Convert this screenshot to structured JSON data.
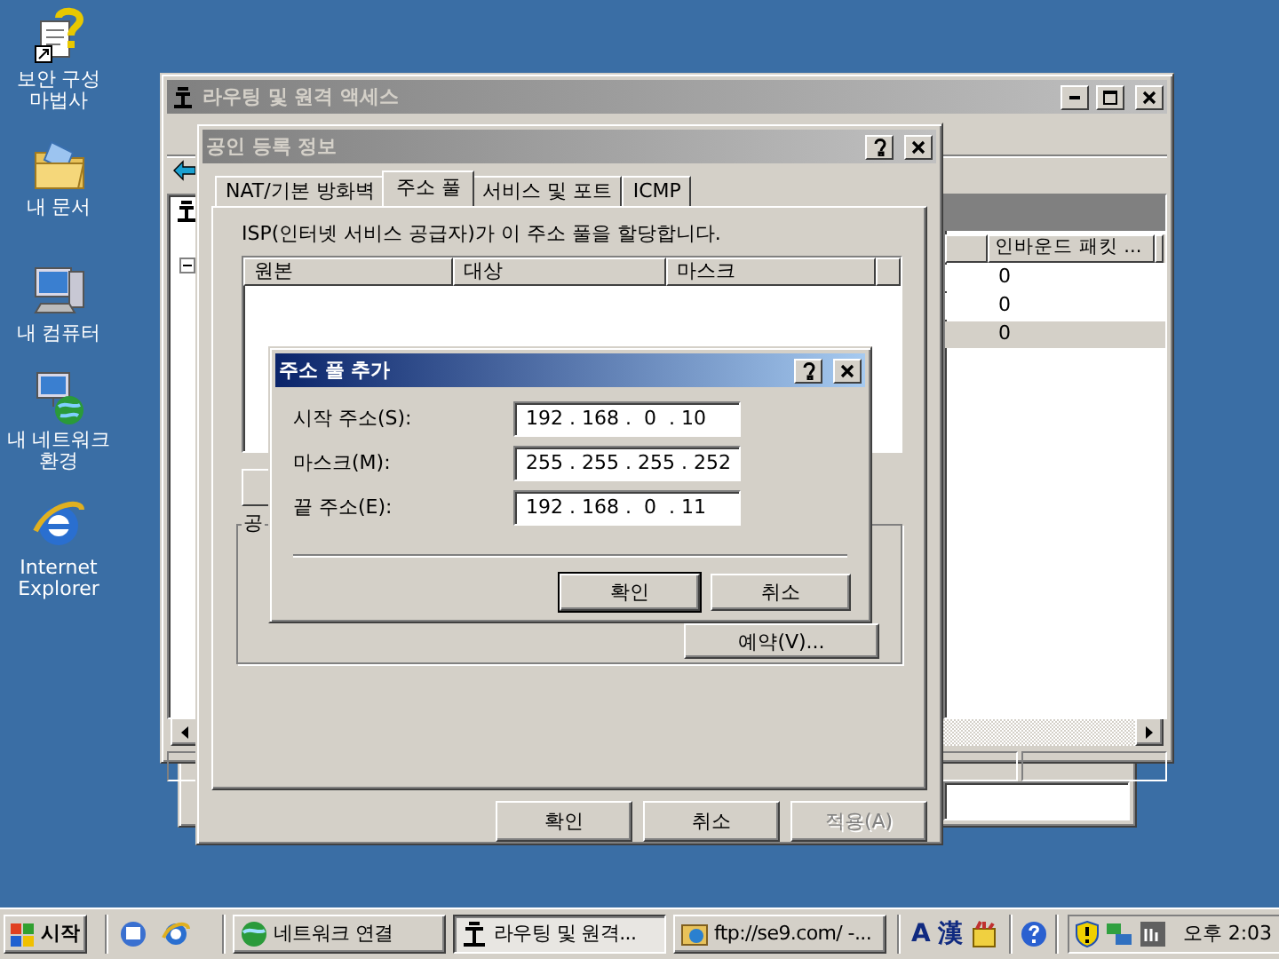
{
  "desktop_icons": [
    {
      "label": "보안 구성 마법사",
      "kind": "wizard"
    },
    {
      "label": "내 문서",
      "kind": "documents"
    },
    {
      "label": "내 컴퓨터",
      "kind": "computer"
    },
    {
      "label": "내 네트워크 환경",
      "kind": "network"
    },
    {
      "label": "Internet Explorer",
      "kind": "browser"
    }
  ],
  "main_window": {
    "title": "라우팅 및 원격 액세스",
    "list": {
      "column_header": "인바운드 패킷 ...",
      "rows": [
        {
          "value": "0",
          "selected": false
        },
        {
          "value": "0",
          "selected": false
        },
        {
          "value": "0",
          "selected": true
        }
      ]
    }
  },
  "properties_dialog": {
    "title": "공인 등록 정보",
    "tabs": [
      {
        "label": "NAT/기본 방화벽",
        "selected": false
      },
      {
        "label": "주소 풀",
        "selected": true
      },
      {
        "label": "서비스 및 포트",
        "selected": false
      },
      {
        "label": "ICMP",
        "selected": false
      }
    ],
    "description": "ISP(인터넷 서비스 공급자)가 이 주소 풀을 할당합니다.",
    "columns": [
      "원본",
      "대상",
      "마스크"
    ],
    "group_label": "공",
    "reserve_button": {
      "label": "예약(V)..."
    },
    "buttons": [
      {
        "label": "확인",
        "disabled": false
      },
      {
        "label": "취소",
        "disabled": false
      },
      {
        "label": "적용(A)",
        "disabled": true
      }
    ]
  },
  "add_dialog": {
    "title": "주소 풀 추가",
    "fields": [
      {
        "label": "시작 주소(S):",
        "value": "192 . 168 .  0  . 10"
      },
      {
        "label": "마스크(M):",
        "value": "255 . 255 . 255 . 252"
      },
      {
        "label": "끝 주소(E):",
        "value": "192 . 168 .  0  . 11"
      }
    ],
    "buttons": [
      {
        "label": "확인",
        "default": true
      },
      {
        "label": "취소",
        "default": false
      }
    ]
  },
  "taskbar": {
    "start": "시작",
    "tasks": [
      {
        "label": "네트워크 연결",
        "kind": "network",
        "selected": false
      },
      {
        "label": "라우팅 및 원격...",
        "kind": "routing",
        "selected": true
      },
      {
        "label": "ftp://se9.com/ -...",
        "kind": "ftp",
        "selected": false
      }
    ],
    "language": [
      "A",
      "漢"
    ],
    "clock": "오후 2:03"
  }
}
